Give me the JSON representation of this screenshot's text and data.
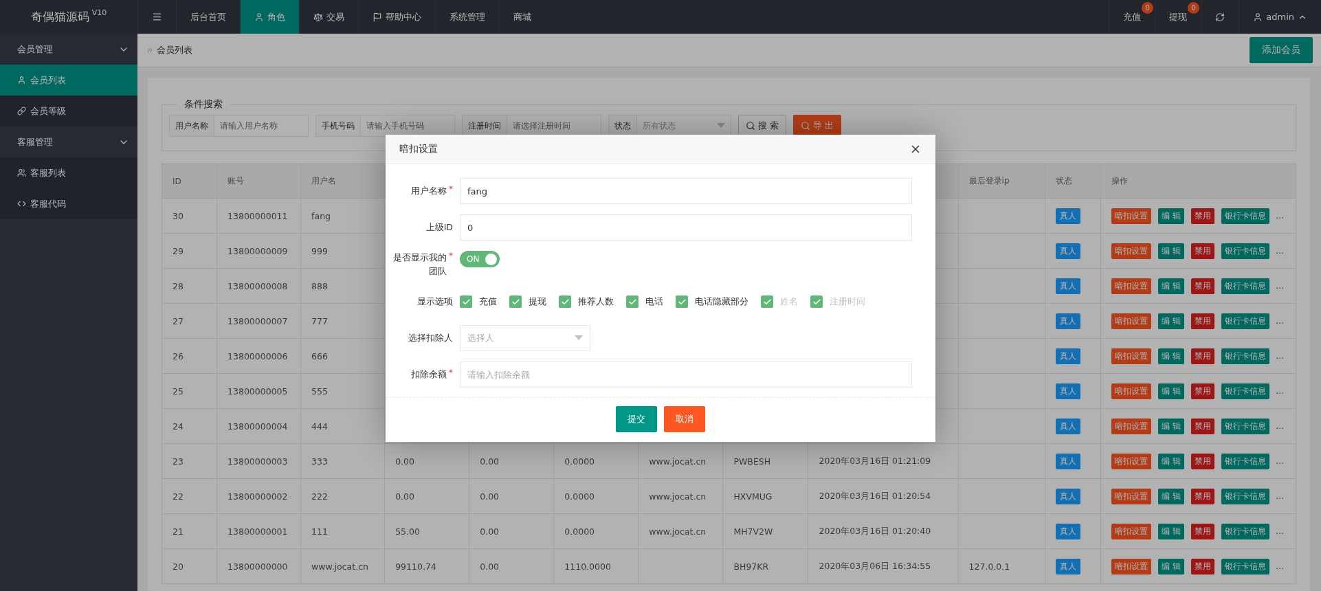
{
  "logo": {
    "name": "奇偶猫源码",
    "version": "V10"
  },
  "topnav": [
    {
      "label": "后台首页",
      "selected": false
    },
    {
      "label": "角色",
      "selected": true
    },
    {
      "label": "交易",
      "selected": false
    },
    {
      "label": "帮助中心",
      "selected": false
    },
    {
      "label": "系统管理",
      "selected": false
    },
    {
      "label": "商城",
      "selected": false
    }
  ],
  "topright": [
    {
      "label": "充值",
      "badge": "0"
    },
    {
      "label": "提现",
      "badge": "0"
    }
  ],
  "user": {
    "name": "admin"
  },
  "sidebar": {
    "groups": [
      {
        "label": "会员管理",
        "expanded": true,
        "children": [
          {
            "label": "会员列表",
            "selected": true
          },
          {
            "label": "会员等级",
            "selected": false
          }
        ]
      },
      {
        "label": "客服管理",
        "expanded": true,
        "children": [
          {
            "label": "客服列表",
            "selected": false
          },
          {
            "label": "客服代码",
            "selected": false
          }
        ]
      }
    ]
  },
  "breadcrumb": "会员列表",
  "add_button": "添加会员",
  "search": {
    "legend": "条件搜索",
    "fields": [
      {
        "label": "用户名称",
        "placeholder": "请输入用户名称",
        "kind": "input"
      },
      {
        "label": "手机号码",
        "placeholder": "请输入手机号码",
        "kind": "input"
      },
      {
        "label": "注册时间",
        "placeholder": "请选择注册时间",
        "kind": "input"
      },
      {
        "label": "状态",
        "placeholder": "所有状态",
        "kind": "select"
      }
    ],
    "search_button": "搜 索",
    "export_button": "导 出"
  },
  "table": {
    "columns": [
      "ID",
      "账号",
      "用户名",
      "最后登录ip",
      "状态",
      "操作"
    ],
    "rows": [
      {
        "id": "30",
        "account": "13800000011",
        "username": "fang",
        "status": "真人",
        "actions": [
          "暗扣设置",
          "编 辑",
          "禁用",
          "银行卡信息"
        ],
        "more": "..."
      },
      {
        "id": "29",
        "account": "13800000009",
        "username": "999",
        "status": "真人",
        "actions": [
          "暗扣设置",
          "编 辑",
          "禁用",
          "银行卡信息"
        ],
        "more": "..."
      },
      {
        "id": "28",
        "account": "13800000008",
        "username": "888",
        "status": "真人",
        "actions": [
          "暗扣设置",
          "编 辑",
          "禁用",
          "银行卡信息"
        ],
        "more": "..."
      },
      {
        "id": "27",
        "account": "13800000007",
        "username": "777",
        "status": "真人",
        "actions": [
          "暗扣设置",
          "编 辑",
          "禁用",
          "银行卡信息"
        ],
        "more": "..."
      },
      {
        "id": "26",
        "account": "13800000006",
        "username": "666",
        "status": "真人",
        "actions": [
          "暗扣设置",
          "编 辑",
          "禁用",
          "银行卡信息"
        ],
        "more": "..."
      },
      {
        "id": "25",
        "account": "13800000005",
        "username": "555",
        "status": "真人",
        "actions": [
          "暗扣设置",
          "编 辑",
          "禁用",
          "银行卡信息"
        ],
        "more": "..."
      },
      {
        "id": "24",
        "account": "13800000004",
        "username": "444",
        "status": "真人",
        "actions": [
          "暗扣设置",
          "编 辑",
          "禁用",
          "银行卡信息"
        ],
        "more": "..."
      },
      {
        "id": "23",
        "account": "13800000003",
        "username": "333",
        "cells": [
          "0.00",
          "0.00",
          "0.0000",
          "www.jocat.cn",
          "PWBESH",
          "2020年03月16日 01:21:09"
        ],
        "status": "真人",
        "actions": [
          "暗扣设置",
          "编 辑",
          "禁用",
          "银行卡信息"
        ],
        "more": "..."
      },
      {
        "id": "22",
        "account": "13800000002",
        "username": "222",
        "cells": [
          "0.00",
          "0.00",
          "0.0000",
          "www.jocat.cn",
          "HXVMUG",
          "2020年03月16日 01:20:54"
        ],
        "status": "真人",
        "actions": [
          "暗扣设置",
          "编 辑",
          "禁用",
          "银行卡信息"
        ],
        "more": "..."
      },
      {
        "id": "21",
        "account": "13800000001",
        "username": "111",
        "cells": [
          "55.00",
          "0.00",
          "0.0000",
          "www.jocat.cn",
          "MH7V2W",
          "2020年03月16日 01:20:40"
        ],
        "status": "真人",
        "actions": [
          "暗扣设置",
          "编 辑",
          "禁用",
          "银行卡信息"
        ],
        "more": "..."
      },
      {
        "id": "20",
        "account": "13800000000",
        "username": "www.jocat.cn",
        "cells": [
          "99110.74",
          "0.00",
          "1110.0000",
          null,
          "BH97KR",
          "2020年03月06日 16:34:55"
        ],
        "ip": "127.0.0.1",
        "status": "真人",
        "actions": [
          "暗扣设置",
          "编 辑",
          "禁用",
          "银行卡信息"
        ],
        "more": "..."
      }
    ]
  },
  "modal": {
    "title": "暗扣设置",
    "fields": [
      {
        "kind": "input",
        "label": "用户名称",
        "required_mark": "*",
        "value": "fang"
      },
      {
        "kind": "input",
        "label": "上级ID",
        "value": "0"
      },
      {
        "kind": "switch",
        "label": "是否显示我的团队",
        "required_mark": "*",
        "text": "ON",
        "on": true
      },
      {
        "kind": "checkboxes",
        "label": "显示选项",
        "options": [
          {
            "label": "充值",
            "checked": true,
            "disabled": false
          },
          {
            "label": "提现",
            "checked": true,
            "disabled": false
          },
          {
            "label": "推荐人数",
            "checked": true,
            "disabled": false
          },
          {
            "label": "电话",
            "checked": true,
            "disabled": false
          },
          {
            "label": "电话隐藏部分",
            "checked": true,
            "disabled": false
          },
          {
            "label": "姓名",
            "checked": true,
            "disabled": true
          },
          {
            "label": "注册时间",
            "checked": true,
            "disabled": true
          }
        ]
      },
      {
        "kind": "select",
        "label": "选择扣除人",
        "placeholder": "选择人"
      },
      {
        "kind": "input",
        "label": "扣除余额",
        "required_mark": "*",
        "placeholder": "请输入扣除余额"
      }
    ],
    "submit": "提交",
    "cancel": "取消"
  }
}
